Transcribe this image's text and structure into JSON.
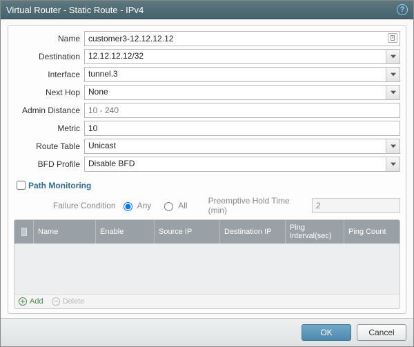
{
  "dialog": {
    "title": "Virtual Router - Static Route - IPv4"
  },
  "form": {
    "name": {
      "label": "Name",
      "value": "customer3-12.12.12.12"
    },
    "destination": {
      "label": "Destination",
      "value": "12.12.12.12/32"
    },
    "interface": {
      "label": "Interface",
      "value": "tunnel.3"
    },
    "nexthop": {
      "label": "Next Hop",
      "value": "None"
    },
    "admindist": {
      "label": "Admin Distance",
      "placeholder": "10 - 240"
    },
    "metric": {
      "label": "Metric",
      "value": "10"
    },
    "routetable": {
      "label": "Route Table",
      "value": "Unicast"
    },
    "bfd": {
      "label": "BFD Profile",
      "value": "Disable BFD"
    }
  },
  "pathmon": {
    "title": "Path Monitoring",
    "failure_label": "Failure Condition",
    "opt_any": "Any",
    "opt_all": "All",
    "preempt_label": "Preemptive Hold Time (min)",
    "preempt_value": "2"
  },
  "grid": {
    "cols": {
      "name": "Name",
      "enable": "Enable",
      "src": "Source IP",
      "dst": "Destination IP",
      "interval": "Ping Interval(sec)",
      "count": "Ping Count"
    },
    "add": "Add",
    "delete": "Delete"
  },
  "buttons": {
    "ok": "OK",
    "cancel": "Cancel"
  }
}
